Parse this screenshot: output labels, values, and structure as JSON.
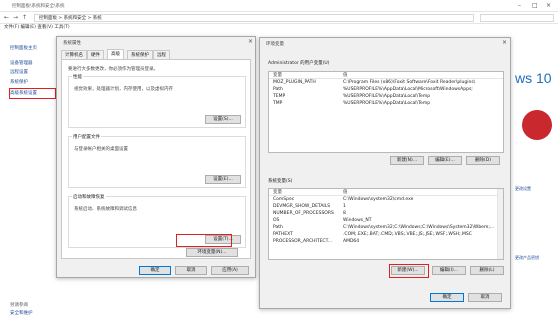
{
  "control_panel": {
    "title": "控制面板\\系统和安全\\系统",
    "address": "控制面板 > 系统和安全 > 系统",
    "menu": "文件(F) 编辑(E) 查看(V) 工具(T)",
    "home_link": "控制面板主页",
    "side_links": [
      "设备管理器",
      "远程设置",
      "系统保护",
      "高级系统设置"
    ],
    "see_also": "另请参阅",
    "security_link": "安全和维护",
    "brand_text": "ws 10",
    "right_link1": "更改设置",
    "right_link2": "更改产品密钥"
  },
  "system_properties": {
    "title": "系统属性",
    "tabs": [
      "计算机名",
      "硬件",
      "高级",
      "系统保护",
      "远程"
    ],
    "admin_note": "要进行大多数更改，你必须作为管理员登录。",
    "performance": {
      "title": "性能",
      "desc": "视觉效果，处理器计划，内存使用，以及虚拟内存",
      "button": "设置(S)..."
    },
    "user_profiles": {
      "title": "用户配置文件",
      "desc": "与登录帐户相关的桌面设置",
      "button": "设置(E)..."
    },
    "startup": {
      "title": "启动和故障恢复",
      "desc": "系统启动、系统故障和调试信息",
      "button": "设置(T)..."
    },
    "env_button": "环境变量(N)...",
    "ok": "确定",
    "cancel": "取消",
    "apply": "应用(A)"
  },
  "env_vars": {
    "title": "环境变量",
    "user_section": "Administrator 的用户变量(U)",
    "col_var": "变量",
    "col_val": "值",
    "user_rows": [
      {
        "name": "MOZ_PLUGIN_PATH",
        "value": "C:\\Program Files (x86)\\Foxit Software\\Foxit Reader\\plugins\\"
      },
      {
        "name": "Path",
        "value": "%USERPROFILE%\\AppData\\Local\\Microsoft\\WindowsApps;"
      },
      {
        "name": "TEMP",
        "value": "%USERPROFILE%\\AppData\\Local\\Temp"
      },
      {
        "name": "TMP",
        "value": "%USERPROFILE%\\AppData\\Local\\Temp"
      }
    ],
    "user_buttons": {
      "new": "新建(N)...",
      "edit": "编辑(E)...",
      "delete": "删除(D)"
    },
    "sys_section": "系统变量(S)",
    "sys_rows": [
      {
        "name": "ComSpec",
        "value": "C:\\Windows\\system32\\cmd.exe"
      },
      {
        "name": "DEVMGR_SHOW_DETAILS",
        "value": "1"
      },
      {
        "name": "NUMBER_OF_PROCESSORS",
        "value": "8"
      },
      {
        "name": "OS",
        "value": "Windows_NT"
      },
      {
        "name": "Path",
        "value": "C:\\Windows\\system32;C:\\Windows;C:\\Windows\\System32\\Wbem;..."
      },
      {
        "name": "PATHEXT",
        "value": ".COM;.EXE;.BAT;.CMD;.VBS;.VBE;.JS;.JSE;.WSF;.WSH;.MSC"
      },
      {
        "name": "PROCESSOR_ARCHITECT...",
        "value": "AMD64"
      }
    ],
    "sys_buttons": {
      "new": "新建(W)...",
      "edit": "编辑(I)...",
      "delete": "删除(L)"
    },
    "ok": "确定",
    "cancel": "取消"
  }
}
